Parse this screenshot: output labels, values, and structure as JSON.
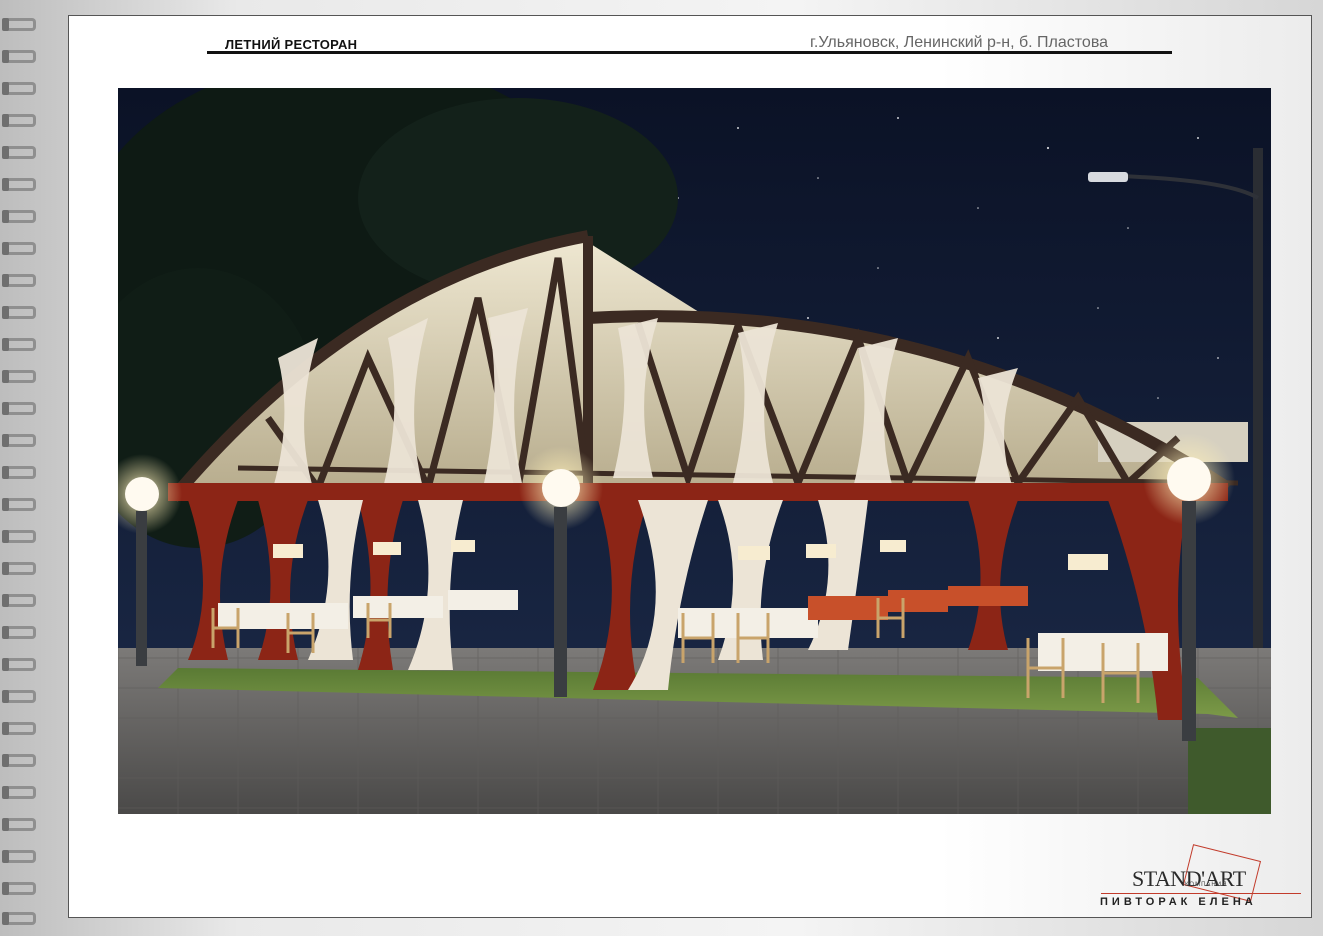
{
  "header": {
    "title": "ЛЕТНИЙ РЕСТОРАН",
    "address": "г.Ульяновск, Ленинский р-н, б. Пластова"
  },
  "logo": {
    "brand": "STAND'ART",
    "company": "КОМПАНИЯ",
    "author": "ПИВТОРАК ЕЛЕНА"
  },
  "colors": {
    "accent": "#c23b2b",
    "night_sky": "#0d1426",
    "lawn": "#6d8a3e",
    "curtain_red": "#8c2516",
    "timber": "#3b2a22"
  }
}
